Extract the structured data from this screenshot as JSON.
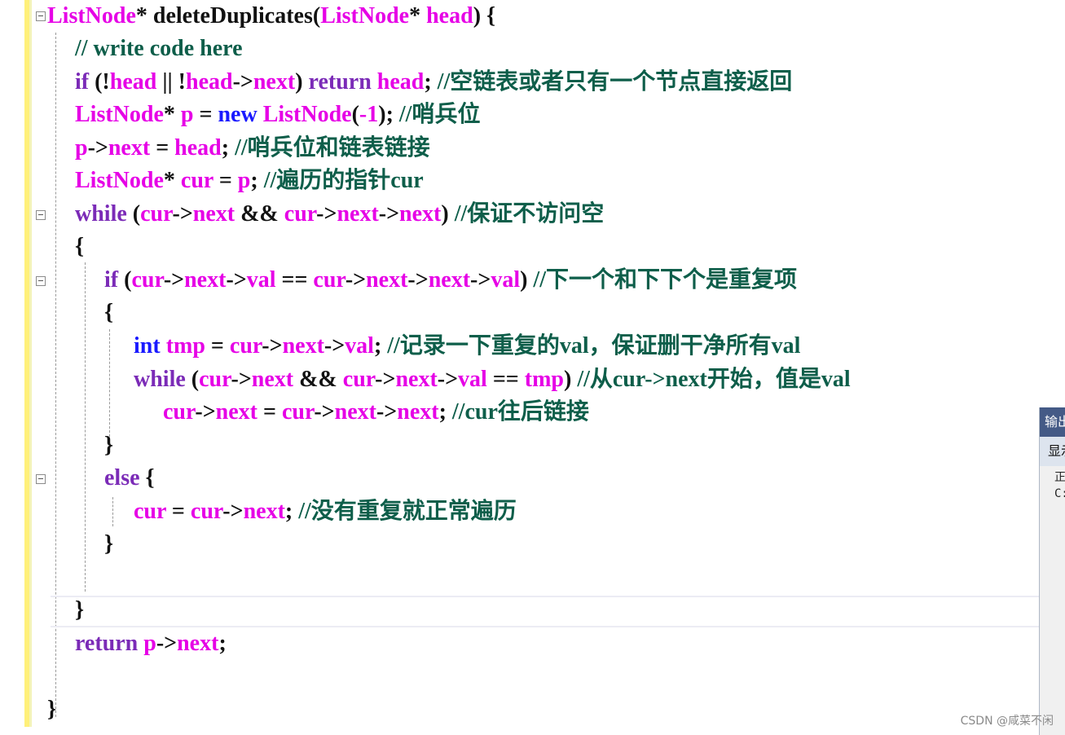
{
  "editor": {
    "lines": [
      [
        [
          "ty",
          "ListNode"
        ],
        [
          "pl",
          "* deleteDuplicates("
        ],
        [
          "ty",
          "ListNode"
        ],
        [
          "pl",
          "* "
        ],
        [
          "id",
          "head"
        ],
        [
          "pl",
          ") {"
        ]
      ],
      [
        [
          "cm",
          "// write code here"
        ]
      ],
      [
        [
          "kw",
          "if"
        ],
        [
          "pl",
          " (!"
        ],
        [
          "id",
          "head"
        ],
        [
          "pl",
          " || !"
        ],
        [
          "id",
          "head"
        ],
        [
          "pl",
          "->"
        ],
        [
          "id",
          "next"
        ],
        [
          "pl",
          ") "
        ],
        [
          "kw",
          "return"
        ],
        [
          "pl",
          " "
        ],
        [
          "id",
          "head"
        ],
        [
          "pl",
          "; "
        ],
        [
          "cm",
          "//空链表或者只有一个节点直接返回"
        ]
      ],
      [
        [
          "ty",
          "ListNode"
        ],
        [
          "pl",
          "* "
        ],
        [
          "id",
          "p"
        ],
        [
          "pl",
          " = "
        ],
        [
          "blue",
          "new"
        ],
        [
          "pl",
          " "
        ],
        [
          "ty",
          "ListNode"
        ],
        [
          "pl",
          "("
        ],
        [
          "id",
          "-1"
        ],
        [
          "pl",
          "); "
        ],
        [
          "cm",
          "//哨兵位"
        ]
      ],
      [
        [
          "id",
          "p"
        ],
        [
          "pl",
          "->"
        ],
        [
          "id",
          "next"
        ],
        [
          "pl",
          " = "
        ],
        [
          "id",
          "head"
        ],
        [
          "pl",
          "; "
        ],
        [
          "cm",
          "//哨兵位和链表链接"
        ]
      ],
      [
        [
          "ty",
          "ListNode"
        ],
        [
          "pl",
          "* "
        ],
        [
          "id",
          "cur"
        ],
        [
          "pl",
          " = "
        ],
        [
          "id",
          "p"
        ],
        [
          "pl",
          "; "
        ],
        [
          "cm",
          "//遍历的指针cur"
        ]
      ],
      [
        [
          "kw",
          "while"
        ],
        [
          "pl",
          " ("
        ],
        [
          "id",
          "cur"
        ],
        [
          "pl",
          "->"
        ],
        [
          "id",
          "next"
        ],
        [
          "pl",
          " && "
        ],
        [
          "id",
          "cur"
        ],
        [
          "pl",
          "->"
        ],
        [
          "id",
          "next"
        ],
        [
          "pl",
          "->"
        ],
        [
          "id",
          "next"
        ],
        [
          "pl",
          ") "
        ],
        [
          "cm",
          "//保证不访问空"
        ]
      ],
      [
        [
          "pl",
          "{"
        ]
      ],
      [
        [
          "kw",
          "if"
        ],
        [
          "pl",
          " ("
        ],
        [
          "id",
          "cur"
        ],
        [
          "pl",
          "->"
        ],
        [
          "id",
          "next"
        ],
        [
          "pl",
          "->"
        ],
        [
          "id",
          "val"
        ],
        [
          "pl",
          " == "
        ],
        [
          "id",
          "cur"
        ],
        [
          "pl",
          "->"
        ],
        [
          "id",
          "next"
        ],
        [
          "pl",
          "->"
        ],
        [
          "id",
          "next"
        ],
        [
          "pl",
          "->"
        ],
        [
          "id",
          "val"
        ],
        [
          "pl",
          ") "
        ],
        [
          "cm",
          "//下一个和下下个是重复项"
        ]
      ],
      [
        [
          "pl",
          "{"
        ]
      ],
      [
        [
          "blue",
          "int"
        ],
        [
          "pl",
          " "
        ],
        [
          "id",
          "tmp"
        ],
        [
          "pl",
          " = "
        ],
        [
          "id",
          "cur"
        ],
        [
          "pl",
          "->"
        ],
        [
          "id",
          "next"
        ],
        [
          "pl",
          "->"
        ],
        [
          "id",
          "val"
        ],
        [
          "pl",
          "; "
        ],
        [
          "cm",
          "//记录一下重复的val，保证删干净所有val"
        ]
      ],
      [
        [
          "kw",
          "while"
        ],
        [
          "pl",
          " ("
        ],
        [
          "id",
          "cur"
        ],
        [
          "pl",
          "->"
        ],
        [
          "id",
          "next"
        ],
        [
          "pl",
          " && "
        ],
        [
          "id",
          "cur"
        ],
        [
          "pl",
          "->"
        ],
        [
          "id",
          "next"
        ],
        [
          "pl",
          "->"
        ],
        [
          "id",
          "val"
        ],
        [
          "pl",
          " == "
        ],
        [
          "id",
          "tmp"
        ],
        [
          "pl",
          ") "
        ],
        [
          "cm",
          "//从cur->next开始，值是val"
        ]
      ],
      [
        [
          "id",
          "cur"
        ],
        [
          "pl",
          "->"
        ],
        [
          "id",
          "next"
        ],
        [
          "pl",
          " = "
        ],
        [
          "id",
          "cur"
        ],
        [
          "pl",
          "->"
        ],
        [
          "id",
          "next"
        ],
        [
          "pl",
          "->"
        ],
        [
          "id",
          "next"
        ],
        [
          "pl",
          "; "
        ],
        [
          "cm",
          "//cur往后链接"
        ]
      ],
      [
        [
          "pl",
          "}"
        ]
      ],
      [
        [
          "kw",
          "else"
        ],
        [
          "pl",
          " {"
        ]
      ],
      [
        [
          "id",
          "cur"
        ],
        [
          "pl",
          " = "
        ],
        [
          "id",
          "cur"
        ],
        [
          "pl",
          "->"
        ],
        [
          "id",
          "next"
        ],
        [
          "pl",
          "; "
        ],
        [
          "cm",
          "//没有重复就正常遍历"
        ]
      ],
      [
        [
          "pl",
          "}"
        ]
      ],
      [],
      [
        [
          "pl",
          "}"
        ]
      ],
      [
        [
          "kw",
          "return"
        ],
        [
          "pl",
          " "
        ],
        [
          "id",
          "p"
        ],
        [
          "pl",
          "->"
        ],
        [
          "id",
          "next"
        ],
        [
          "pl",
          ";"
        ]
      ],
      [],
      [
        [
          "pl",
          "}"
        ]
      ]
    ]
  },
  "colors": {
    "keyword": "#7b2bb7",
    "type": "#e600e6",
    "identifier": "#e600e6",
    "new_int": "#1a1aff",
    "comment": "#0e5e4a",
    "plain": "#111111",
    "margin": "#fff07a"
  },
  "output_panel": {
    "title": "输出",
    "toolbar_label": "显示",
    "text_lines": [
      "正",
      "C:"
    ]
  },
  "watermark": "CSDN @咸菜不闲",
  "icons": {
    "fold": "collapse-minus-icon"
  }
}
